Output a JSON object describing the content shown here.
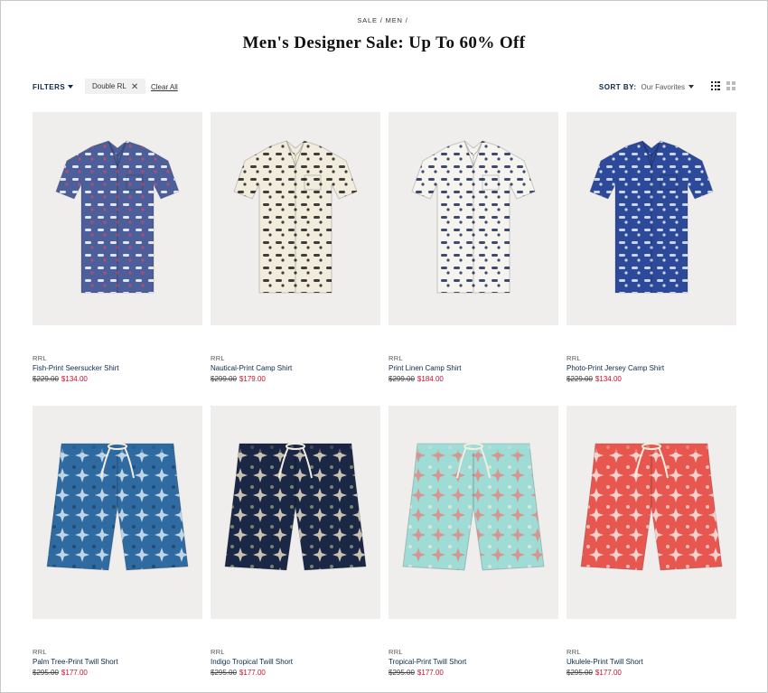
{
  "breadcrumb": {
    "items": [
      "SALE",
      "MEN"
    ],
    "sep": "/"
  },
  "title": "Men's Designer Sale: Up To 60% Off",
  "toolbar": {
    "filters_label": "FILTERS",
    "chip_label": "Double RL",
    "clear_all": "Clear All",
    "sort_label": "SORT BY:",
    "sort_value": "Our Favorites"
  },
  "colors": {
    "navy": "#0b2a4a",
    "sale_red": "#c8102e",
    "image_bg": "#efeeec"
  },
  "products": [
    {
      "brand": "RRL",
      "name": "Fish-Print Seersucker Shirt",
      "old_price": "$229.00",
      "new_price": "$134.00",
      "kind": "shirt",
      "bg": "#4d5f9a",
      "print": "#ffffff",
      "accent": "#c44a6a",
      "icon": "fish-print-shirt-image"
    },
    {
      "brand": "RRL",
      "name": "Nautical-Print Camp Shirt",
      "old_price": "$299.00",
      "new_price": "$179.00",
      "kind": "shirt",
      "bg": "#f1ecdc",
      "print": "#1f1f1f",
      "accent": "#1f1f1f",
      "icon": "nautical-print-shirt-image"
    },
    {
      "brand": "RRL",
      "name": "Print Linen Camp Shirt",
      "old_price": "$299.00",
      "new_price": "$184.00",
      "kind": "shirt",
      "bg": "#f6f4ee",
      "print": "#1e2c5e",
      "accent": "#1e2c5e",
      "icon": "linen-camp-shirt-image"
    },
    {
      "brand": "RRL",
      "name": "Photo-Print Jersey Camp Shirt",
      "old_price": "$229.00",
      "new_price": "$134.00",
      "kind": "shirt",
      "bg": "#2d4a9a",
      "print": "#e9eef7",
      "accent": "#e9eef7",
      "icon": "photo-print-shirt-image"
    },
    {
      "brand": "RRL",
      "name": "Palm Tree-Print Twill Short",
      "old_price": "$295.00",
      "new_price": "$177.00",
      "kind": "short",
      "bg": "#2f6aa0",
      "print": "#d8e8f2",
      "accent": "#1c3f66",
      "icon": "palm-tree-short-image"
    },
    {
      "brand": "RRL",
      "name": "Indigo Tropical Twill Short",
      "old_price": "$295.00",
      "new_price": "$177.00",
      "kind": "short",
      "bg": "#1a2745",
      "print": "#e6dcc4",
      "accent": "#9bab7c",
      "icon": "indigo-tropical-short-image"
    },
    {
      "brand": "RRL",
      "name": "Tropical-Print Twill Short",
      "old_price": "$295.00",
      "new_price": "$177.00",
      "kind": "short",
      "bg": "#9fdcd6",
      "print": "#e08a86",
      "accent": "#f3ecd6",
      "icon": "tropical-print-short-image"
    },
    {
      "brand": "RRL",
      "name": "Ukulele-Print Twill Short",
      "old_price": "$295.00",
      "new_price": "$177.00",
      "kind": "short",
      "bg": "#e8574f",
      "print": "#fbe6e2",
      "accent": "#fbe6e2",
      "icon": "ukulele-print-short-image"
    }
  ]
}
